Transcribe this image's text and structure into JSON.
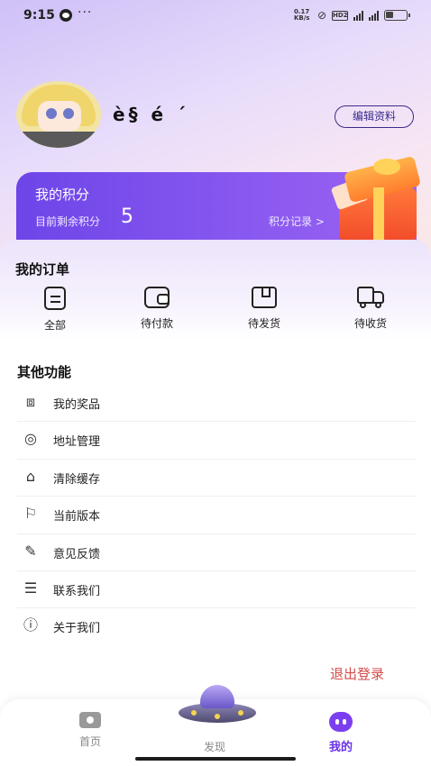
{
  "status_bar": {
    "time": "9:15",
    "more": "···",
    "net_speed": "0.17 KB/s",
    "hd_badge": "HD2",
    "battery_level": 0.3
  },
  "profile": {
    "username": "è§ é ´",
    "edit_label": "编辑资料"
  },
  "points": {
    "title": "我的积分",
    "remaining_label": "目前剩余积分",
    "value": "5",
    "record_label": "积分记录 >"
  },
  "orders": {
    "title": "我的订单",
    "items": [
      {
        "label": "全部",
        "icon": "clipboard-icon"
      },
      {
        "label": "待付款",
        "icon": "wallet-icon"
      },
      {
        "label": "待发货",
        "icon": "package-icon"
      },
      {
        "label": "待收货",
        "icon": "truck-icon"
      }
    ]
  },
  "other": {
    "title": "其他功能",
    "items": [
      {
        "label": "我的奖品",
        "icon": "prize-icon"
      },
      {
        "label": "地址管理",
        "icon": "location-icon"
      },
      {
        "label": "清除缓存",
        "icon": "broom-icon"
      },
      {
        "label": "当前版本",
        "icon": "flag-icon"
      },
      {
        "label": "意见反馈",
        "icon": "feedback-icon"
      },
      {
        "label": "联系我们",
        "icon": "chat-icon"
      },
      {
        "label": "关于我们",
        "icon": "info-icon"
      }
    ]
  },
  "logout_label": "退出登录",
  "tab_bar": {
    "tabs": [
      {
        "label": "首页",
        "icon": "home-icon"
      },
      {
        "label": "发现",
        "icon": "ufo-icon"
      },
      {
        "label": "我的",
        "icon": "mine-icon"
      }
    ],
    "active": "我的",
    "active_color": "#6a32e6"
  },
  "colors": {
    "accent": "#7b3ff0",
    "points_card": "#7a4ef0",
    "logout": "#d64a4a"
  }
}
